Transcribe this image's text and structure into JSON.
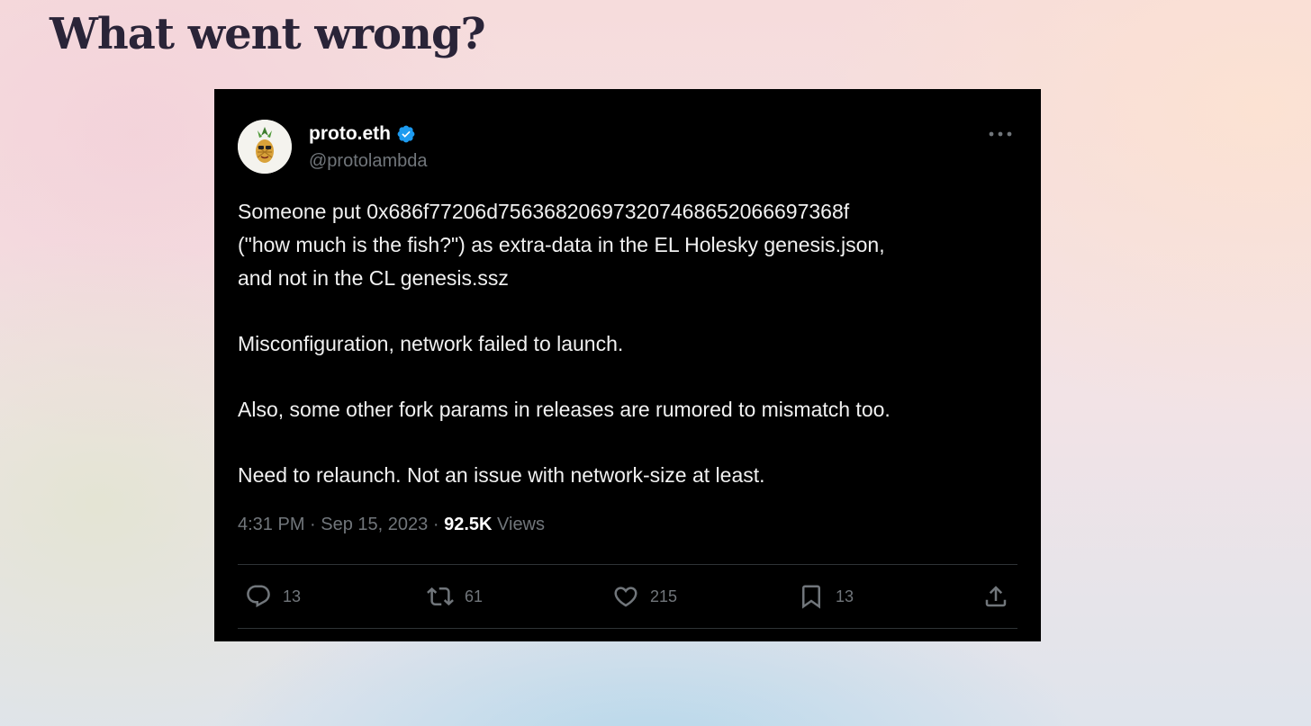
{
  "slide": {
    "title": "What went wrong?"
  },
  "tweet": {
    "author": {
      "display_name": "proto.eth",
      "handle": "@protolambda",
      "verified": true,
      "verified_color": "#1d9bf0"
    },
    "paragraphs": [
      "Someone put 0x686f77206d756368206973207468652066697368f\n(\"how much is the fish?\") as extra-data in the EL Holesky genesis.json,\nand not in the CL genesis.ssz",
      "Misconfiguration, network failed to launch.",
      "Also, some other fork params in releases are rumored to mismatch too.",
      "Need to relaunch. Not an issue with network-size at least."
    ],
    "time": "4:31 PM",
    "separator": "·",
    "date": "Sep 15, 2023",
    "views_count": "92.5K",
    "views_label": "Views",
    "actions": {
      "replies": "13",
      "reposts": "61",
      "likes": "215",
      "bookmarks": "13"
    },
    "icons": {
      "more": "more-horizontal-icon",
      "reply": "comment-bubble-icon",
      "repost": "repost-arrows-icon",
      "like": "heart-icon",
      "bookmark": "bookmark-icon",
      "share": "share-upload-icon"
    }
  }
}
